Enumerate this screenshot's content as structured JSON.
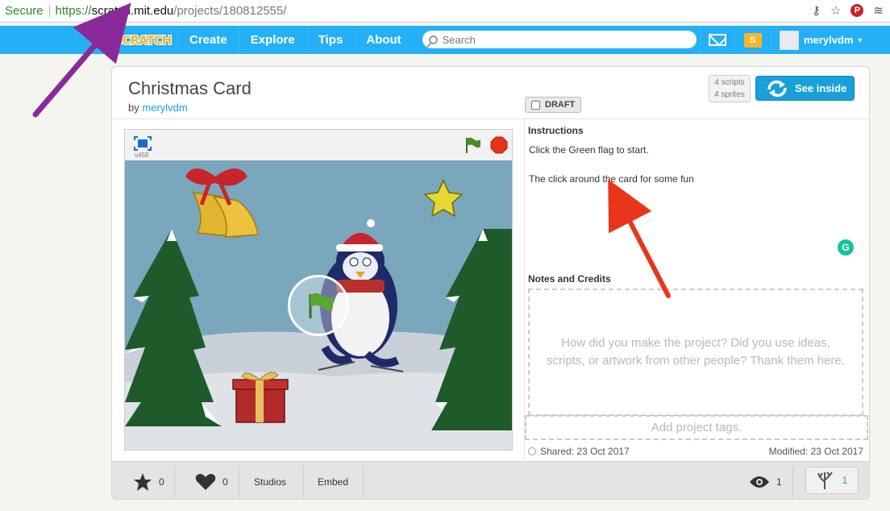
{
  "browser": {
    "secure_label": "Secure",
    "url_scheme": "https://",
    "url_host": "scratch.mit.edu",
    "url_path": "/projects/180812555/"
  },
  "nav": {
    "logo_text": "SCRATCH",
    "items": [
      "Create",
      "Explore",
      "Tips",
      "About"
    ],
    "search_placeholder": "Search",
    "username": "merylvdm"
  },
  "project": {
    "title": "Christmas Card",
    "by_label": "by",
    "author": "merylvdm",
    "draft_label": "DRAFT",
    "scripts_count": "4",
    "scripts_label": "scripts",
    "sprites_count": "4",
    "sprites_label": "sprites",
    "see_inside_label": "See inside",
    "version": "v458"
  },
  "instructions": {
    "heading": "Instructions",
    "lines": [
      "Click the Green flag to start.",
      "The click around the card for some fun"
    ]
  },
  "notes": {
    "heading": "Notes and Credits",
    "placeholder": "How did you make the project? Did you use ideas, scripts, or artwork from other people? Thank them here."
  },
  "tags": {
    "placeholder": "Add project tags."
  },
  "dates": {
    "shared": "Shared: 23 Oct 2017",
    "modified": "Modified: 23 Oct 2017"
  },
  "bottombar": {
    "favorites_count": "0",
    "loves_count": "0",
    "studios_label": "Studios",
    "embed_label": "Embed",
    "views_count": "1",
    "remixes_count": "1"
  },
  "colors": {
    "nav_blue": "#25aff4",
    "link_blue": "#1aa0d8",
    "annotation_purple": "#8a2a9a",
    "annotation_red": "#e8361a"
  }
}
